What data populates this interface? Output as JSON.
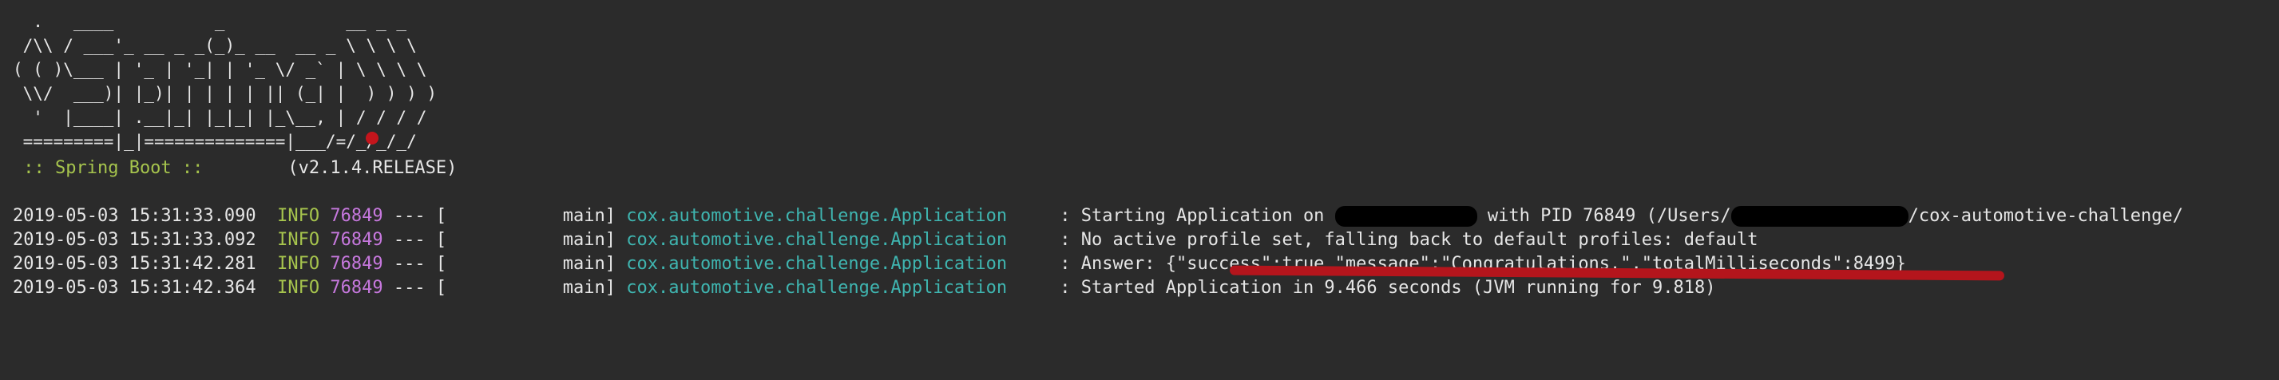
{
  "banner": {
    "ascii_art": "  .   ____          _            __ _ _\n /\\\\ / ___'_ __ _ _(_)_ __  __ _ \\ \\ \\ \\\n( ( )\\___ | '_ | '_| | '_ \\/ _` | \\ \\ \\ \\\n \\\\/  ___)| |_)| | | | | || (_| |  ) ) ) )\n  '  |____| .__|_| |_|_| |_\\__, | / / / /\n =========|_|==============|___/=/_/_/_/",
    "boot_label": " :: Spring Boot :: ",
    "boot_version": "       (v2.1.4.RELEASE)"
  },
  "colors": {
    "background": "#2b2b2b",
    "level": "#a6c44d",
    "pid": "#c678dd",
    "logger": "#3fb5b0",
    "annotation": "#b4151c"
  },
  "log": [
    {
      "date": "2019-05-03 15:31:33.090",
      "level": "INFO",
      "pid": "76849",
      "sep": " --- [           main] ",
      "logger": "cox.automotive.challenge.Application",
      "message": "     : Starting Application on ",
      "message_after_redaction": " with PID 76849 (/Users/",
      "message_tail": "/cox-automotive-challenge/"
    },
    {
      "date": "2019-05-03 15:31:33.092",
      "level": "INFO",
      "pid": "76849",
      "sep": " --- [           main] ",
      "logger": "cox.automotive.challenge.Application",
      "message": "     : No active profile set, falling back to default profiles: default"
    },
    {
      "date": "2019-05-03 15:31:42.281",
      "level": "INFO",
      "pid": "76849",
      "sep": " --- [           main] ",
      "logger": "cox.automotive.challenge.Application",
      "message": "     : Answer: {\"success\":true,\"message\":\"Congratulations.\",\"totalMilliseconds\":8499}"
    },
    {
      "date": "2019-05-03 15:31:42.364",
      "level": "INFO",
      "pid": "76849",
      "sep": " --- [           main] ",
      "logger": "cox.automotive.challenge.Application",
      "message": "     : Started Application in 9.466 seconds (JVM running for 9.818)"
    }
  ]
}
